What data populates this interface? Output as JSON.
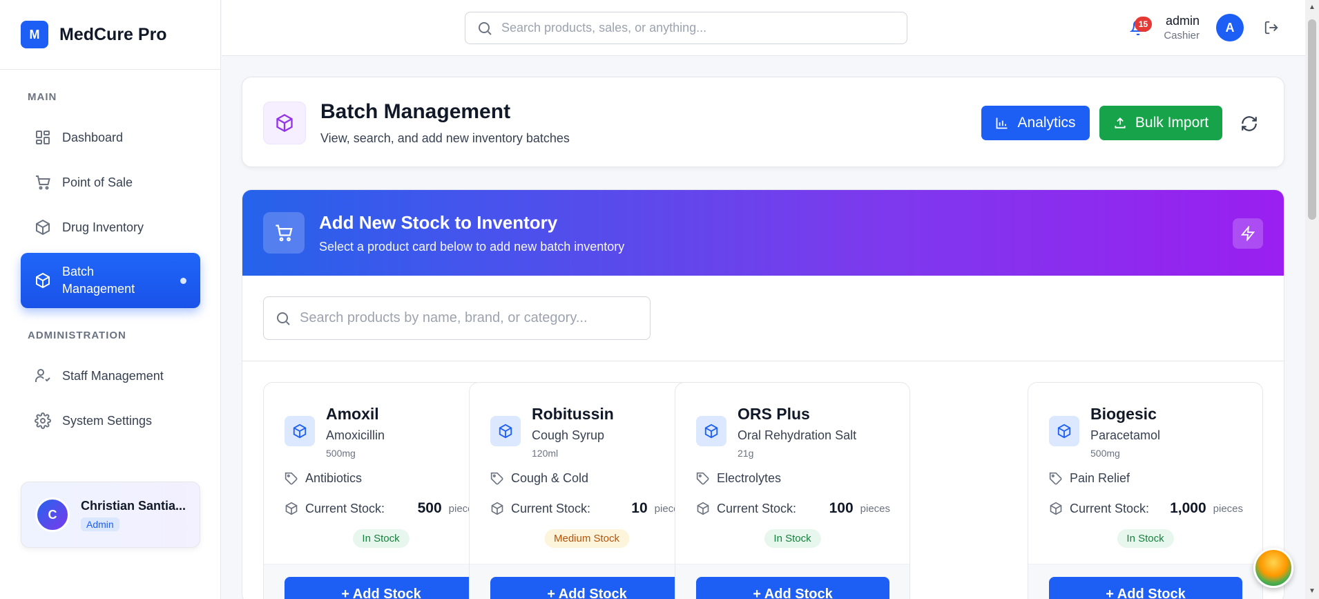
{
  "brand": {
    "logo_letter": "M",
    "name": "MedCure Pro"
  },
  "sidebar": {
    "sections": {
      "main": "MAIN",
      "admin": "ADMINISTRATION"
    },
    "items": [
      {
        "label": "Dashboard",
        "icon": "dashboard-icon"
      },
      {
        "label": "Point of Sale",
        "icon": "cart-icon"
      },
      {
        "label": "Drug Inventory",
        "icon": "box-icon"
      },
      {
        "label": "Batch Management",
        "icon": "box-icon",
        "active": true
      },
      {
        "label": "Staff Management",
        "icon": "user-check-icon"
      },
      {
        "label": "System Settings",
        "icon": "gear-icon"
      }
    ],
    "user": {
      "initial": "C",
      "name": "Christian Santia...",
      "role": "Admin"
    }
  },
  "topbar": {
    "search_placeholder": "Search products, sales, or anything...",
    "notification_count": "15",
    "user_name": "admin",
    "user_role": "Cashier",
    "avatar_initial": "A"
  },
  "header": {
    "title": "Batch Management",
    "subtitle": "View, search, and add new inventory batches",
    "analytics_label": "Analytics",
    "import_label": "Bulk Import"
  },
  "add_stock": {
    "title": "Add New Stock to Inventory",
    "subtitle": "Select a product card below to add new batch inventory",
    "search_placeholder": "Search products by name, brand, or category...",
    "current_stock_label": "Current Stock:",
    "unit": "pieces",
    "add_button": "+ Add Stock"
  },
  "products": [
    {
      "name": "Amoxil",
      "generic": "Amoxicillin",
      "strength": "500mg",
      "category": "Antibiotics",
      "stock": "500",
      "status": "In Stock",
      "status_type": "in"
    },
    {
      "name": "Robitussin",
      "generic": "Cough Syrup",
      "strength": "120ml",
      "category": "Cough & Cold",
      "stock": "10",
      "status": "Medium Stock",
      "status_type": "med"
    },
    {
      "name": "ORS Plus",
      "generic": "Oral Rehydration Salt",
      "strength": "21g",
      "category": "Electrolytes",
      "stock": "100",
      "status": "In Stock",
      "status_type": "in"
    },
    {
      "name": "Biogesic",
      "generic": "Paracetamol",
      "strength": "500mg",
      "category": "Pain Relief",
      "stock": "1,000",
      "status": "In Stock",
      "status_type": "in"
    }
  ],
  "colors": {
    "primary": "#1d5ef5",
    "success": "#16a34a",
    "accent_purple": "#9333ea"
  }
}
